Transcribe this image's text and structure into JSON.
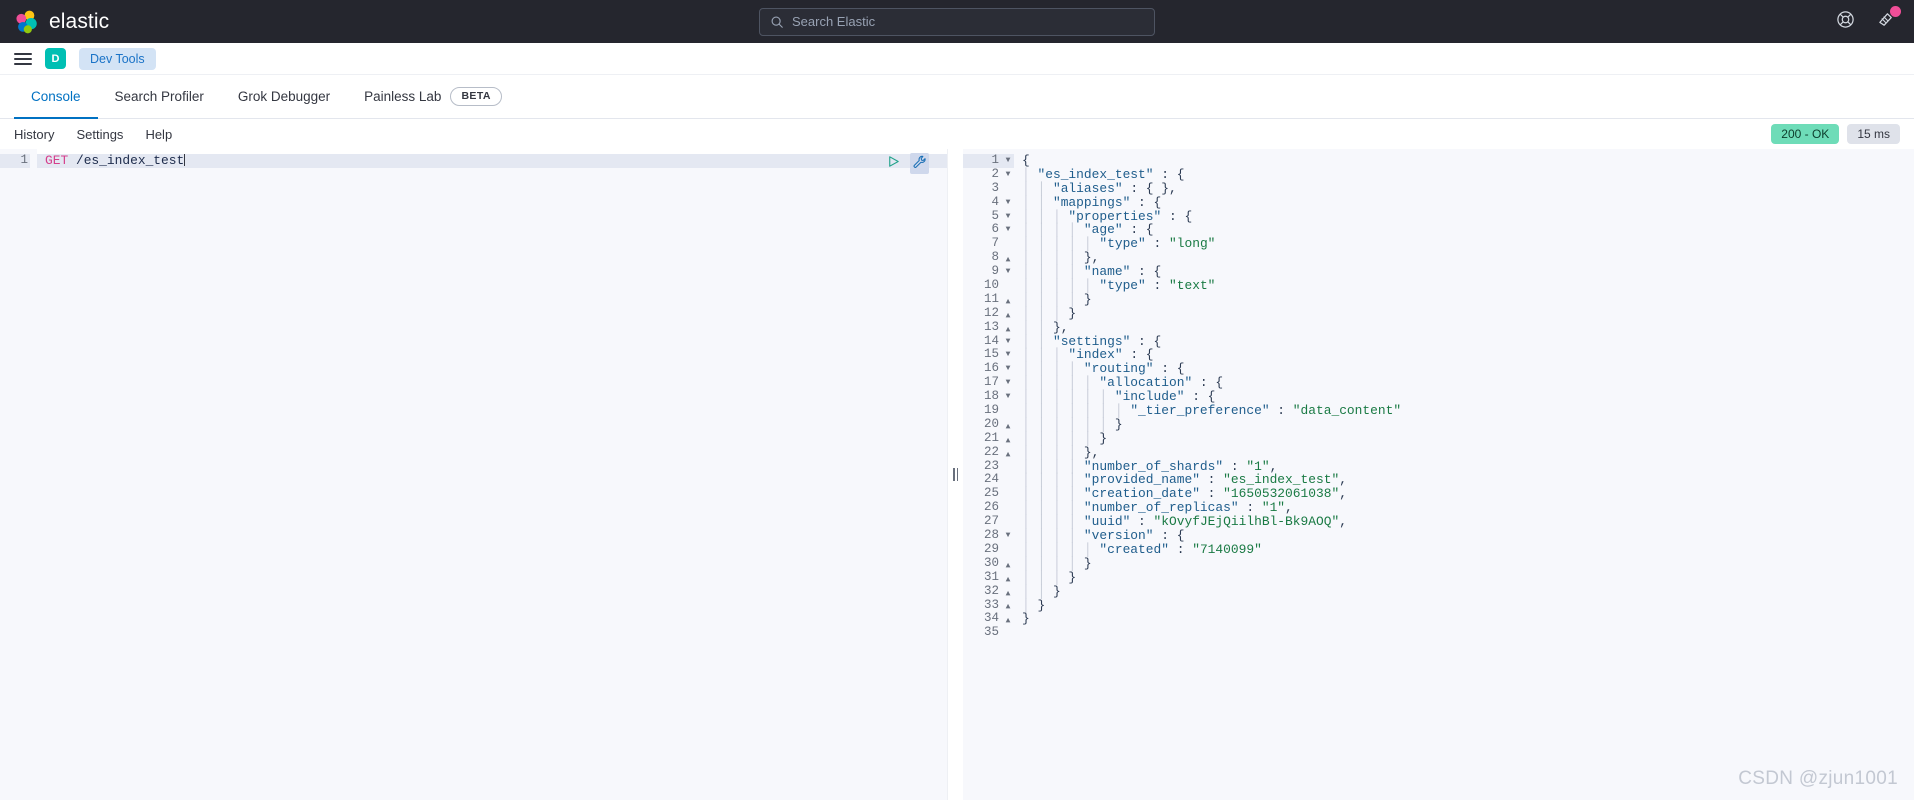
{
  "header": {
    "brand": "elastic",
    "search_placeholder": "Search Elastic",
    "search_value": "",
    "help_icon": "help-lifebuoy-icon",
    "news_icon": "news-megaphone-icon"
  },
  "chrome": {
    "menu_icon": "hamburger-menu-icon",
    "space_initial": "D",
    "breadcrumb": "Dev Tools"
  },
  "tabs": [
    {
      "label": "Console",
      "active": true,
      "badge": ""
    },
    {
      "label": "Search Profiler",
      "active": false,
      "badge": ""
    },
    {
      "label": "Grok Debugger",
      "active": false,
      "badge": ""
    },
    {
      "label": "Painless Lab",
      "active": false,
      "badge": "BETA"
    }
  ],
  "console_toolbar": {
    "links": [
      "History",
      "Settings",
      "Help"
    ],
    "status_code": "200 - OK",
    "elapsed": "15 ms"
  },
  "request_editor": {
    "line_number": "1",
    "method": "GET",
    "path": " /es_index_test",
    "play_icon": "play-run-request-icon",
    "wrench_icon": "wrench-console-menu-icon"
  },
  "splitter": {
    "icon": "drag-handle-icon"
  },
  "response": {
    "lines": [
      {
        "n": "1",
        "fold": "down",
        "indent": 0,
        "text": "{"
      },
      {
        "n": "2",
        "fold": "down",
        "indent": 1,
        "text": "\"es_index_test\" : {"
      },
      {
        "n": "3",
        "fold": "none",
        "indent": 2,
        "text": "\"aliases\" : { },"
      },
      {
        "n": "4",
        "fold": "down",
        "indent": 2,
        "text": "\"mappings\" : {"
      },
      {
        "n": "5",
        "fold": "down",
        "indent": 3,
        "text": "\"properties\" : {"
      },
      {
        "n": "6",
        "fold": "down",
        "indent": 4,
        "text": "\"age\" : {"
      },
      {
        "n": "7",
        "fold": "none",
        "indent": 5,
        "text": "\"type\" : \"long\""
      },
      {
        "n": "8",
        "fold": "up",
        "indent": 4,
        "text": "},"
      },
      {
        "n": "9",
        "fold": "down",
        "indent": 4,
        "text": "\"name\" : {"
      },
      {
        "n": "10",
        "fold": "none",
        "indent": 5,
        "text": "\"type\" : \"text\""
      },
      {
        "n": "11",
        "fold": "up",
        "indent": 4,
        "text": "}"
      },
      {
        "n": "12",
        "fold": "up",
        "indent": 3,
        "text": "}"
      },
      {
        "n": "13",
        "fold": "up",
        "indent": 2,
        "text": "},"
      },
      {
        "n": "14",
        "fold": "down",
        "indent": 2,
        "text": "\"settings\" : {"
      },
      {
        "n": "15",
        "fold": "down",
        "indent": 3,
        "text": "\"index\" : {"
      },
      {
        "n": "16",
        "fold": "down",
        "indent": 4,
        "text": "\"routing\" : {"
      },
      {
        "n": "17",
        "fold": "down",
        "indent": 5,
        "text": "\"allocation\" : {"
      },
      {
        "n": "18",
        "fold": "down",
        "indent": 6,
        "text": "\"include\" : {"
      },
      {
        "n": "19",
        "fold": "none",
        "indent": 7,
        "text": "\"_tier_preference\" : \"data_content\""
      },
      {
        "n": "20",
        "fold": "up",
        "indent": 6,
        "text": "}"
      },
      {
        "n": "21",
        "fold": "up",
        "indent": 5,
        "text": "}"
      },
      {
        "n": "22",
        "fold": "up",
        "indent": 4,
        "text": "},"
      },
      {
        "n": "23",
        "fold": "none",
        "indent": 4,
        "text": "\"number_of_shards\" : \"1\","
      },
      {
        "n": "24",
        "fold": "none",
        "indent": 4,
        "text": "\"provided_name\" : \"es_index_test\","
      },
      {
        "n": "25",
        "fold": "none",
        "indent": 4,
        "text": "\"creation_date\" : \"1650532061038\","
      },
      {
        "n": "26",
        "fold": "none",
        "indent": 4,
        "text": "\"number_of_replicas\" : \"1\","
      },
      {
        "n": "27",
        "fold": "none",
        "indent": 4,
        "text": "\"uuid\" : \"kOvyfJEjQiilhBl-Bk9AOQ\","
      },
      {
        "n": "28",
        "fold": "down",
        "indent": 4,
        "text": "\"version\" : {"
      },
      {
        "n": "29",
        "fold": "none",
        "indent": 5,
        "text": "\"created\" : \"7140099\""
      },
      {
        "n": "30",
        "fold": "up",
        "indent": 4,
        "text": "}"
      },
      {
        "n": "31",
        "fold": "up",
        "indent": 3,
        "text": "}"
      },
      {
        "n": "32",
        "fold": "up",
        "indent": 2,
        "text": "}"
      },
      {
        "n": "33",
        "fold": "up",
        "indent": 1,
        "text": "}"
      },
      {
        "n": "34",
        "fold": "up",
        "indent": 0,
        "text": "}"
      },
      {
        "n": "35",
        "fold": "none",
        "indent": 0,
        "text": ""
      }
    ]
  },
  "watermark": "CSDN @zjun1001",
  "colors": {
    "header_bg": "#25262e",
    "accent_blue": "#0071c2",
    "space_teal": "#00bfb3",
    "status_green": "#6edcb8",
    "badge_pink": "#f04e98",
    "method_pink": "#d53f8c",
    "json_key": "#1f5d8c",
    "json_string": "#1a7a44"
  }
}
